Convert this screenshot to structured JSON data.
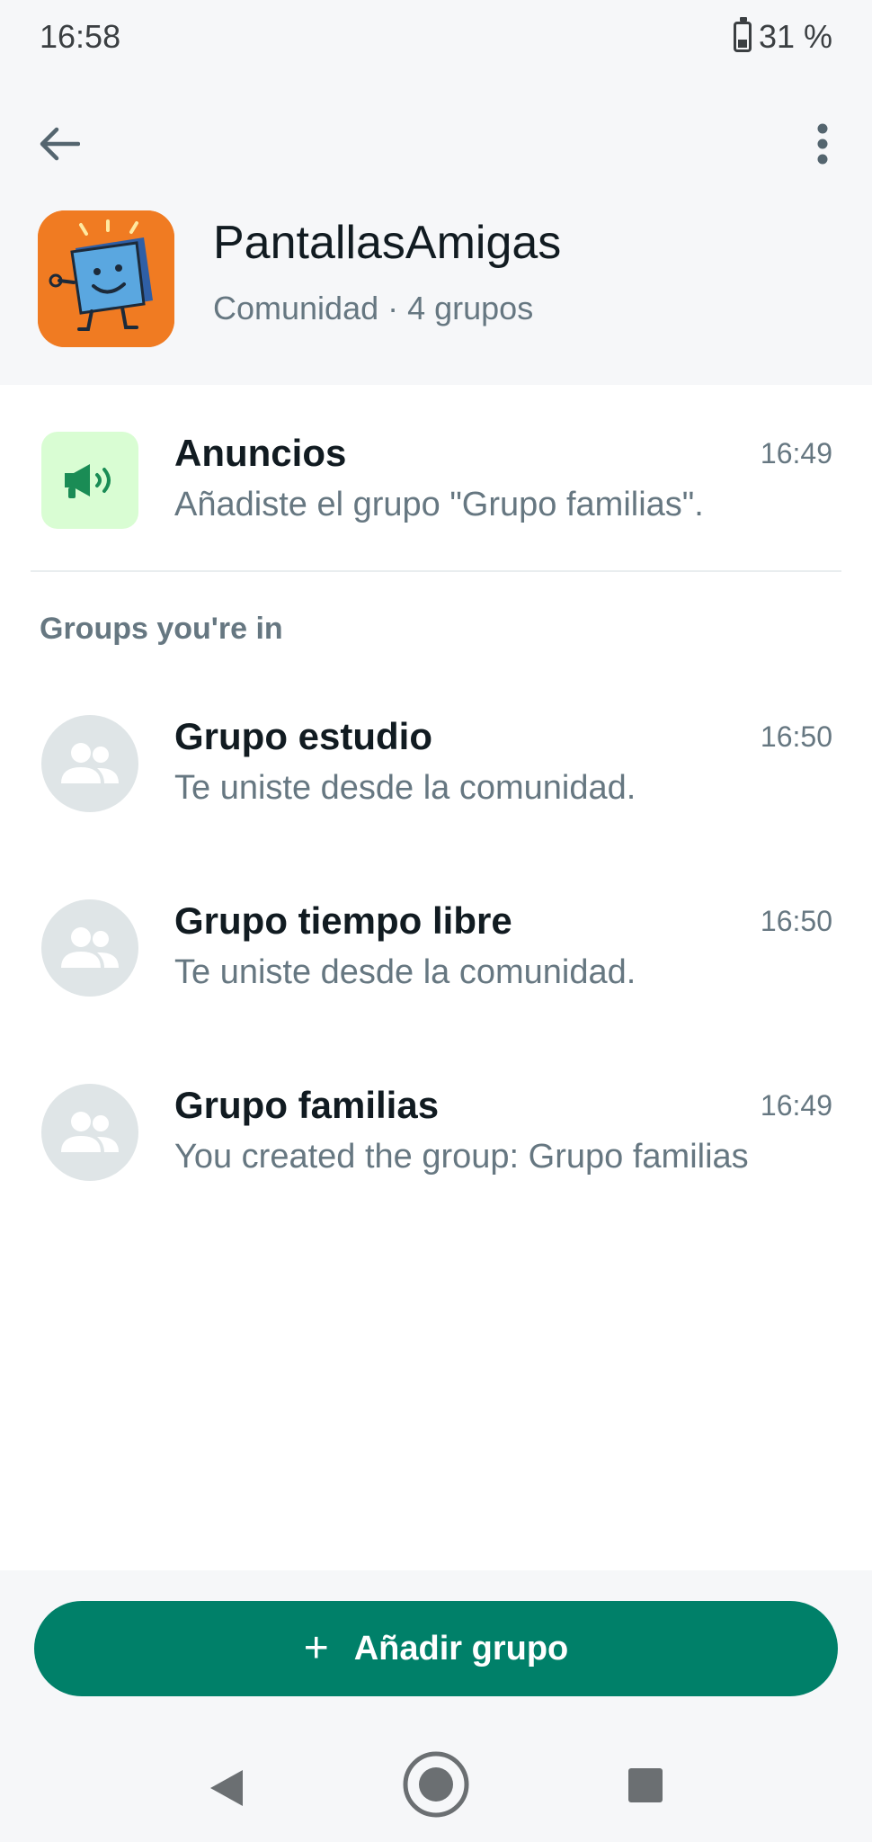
{
  "status_bar": {
    "time": "16:58",
    "battery": "31 %",
    "battery_level": 0.31
  },
  "header": {
    "title": "PantallasAmigas",
    "subtitle": "Comunidad · 4 grupos",
    "icons": {
      "back": "arrow-left-icon",
      "menu": "more-vert-icon"
    }
  },
  "announcements": {
    "title": "Anuncios",
    "time": "16:49",
    "preview": "Añadiste el grupo \"Grupo familias\".",
    "icon": "megaphone-icon"
  },
  "section": {
    "label": "Groups you're in"
  },
  "groups": [
    {
      "title": "Grupo estudio",
      "time": "16:50",
      "preview": "Te uniste desde la comunidad."
    },
    {
      "title": "Grupo tiempo libre",
      "time": "16:50",
      "preview": "Te uniste desde la comunidad."
    },
    {
      "title": "Grupo familias",
      "time": "16:49",
      "preview": "You created the group: Grupo familias"
    }
  ],
  "add_group": {
    "label": "Añadir grupo",
    "icon": "plus-icon"
  },
  "nav": {
    "back": "nav-back-icon",
    "home": "nav-home-icon",
    "recents": "nav-recents-icon"
  },
  "colors": {
    "accent": "#008069",
    "announce_bg": "#d9fdd3",
    "logo_bg": "#f07b22"
  }
}
